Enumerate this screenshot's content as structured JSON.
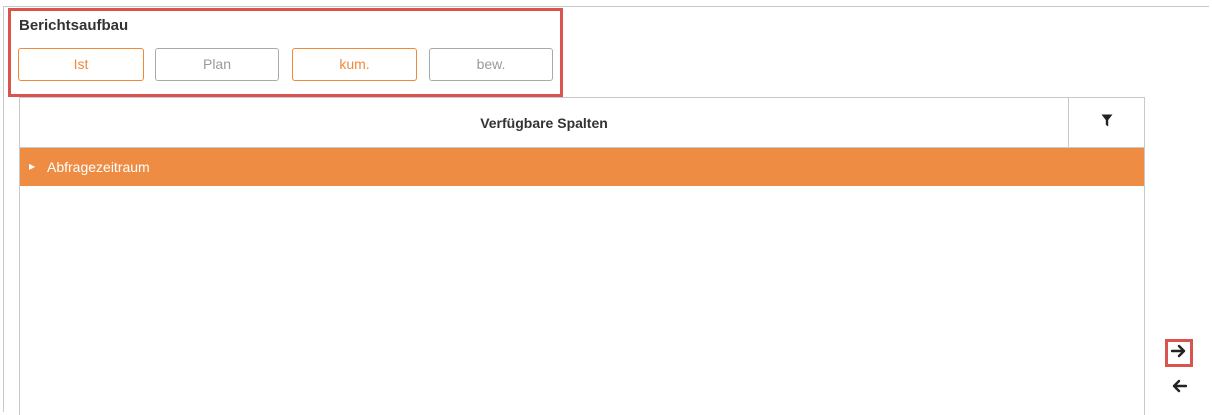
{
  "report_structure": {
    "title": "Berichtsaufbau",
    "buttons": [
      {
        "label": "Ist",
        "active": true
      },
      {
        "label": "Plan",
        "active": false
      },
      {
        "label": "kum.",
        "active": true
      },
      {
        "label": "bew.",
        "active": false
      }
    ]
  },
  "available_columns": {
    "title": "Verfügbare Spalten",
    "filter_icon": "filter-icon",
    "groups": [
      {
        "label": "Abfragezeitraum",
        "expanded": false
      }
    ]
  },
  "transfer": {
    "move_right_icon": "arrow-right-icon",
    "move_left_icon": "arrow-left-icon"
  },
  "colors": {
    "accent": "#ee8c44",
    "highlight": "#d9534f",
    "button_active": "#f0883a"
  }
}
